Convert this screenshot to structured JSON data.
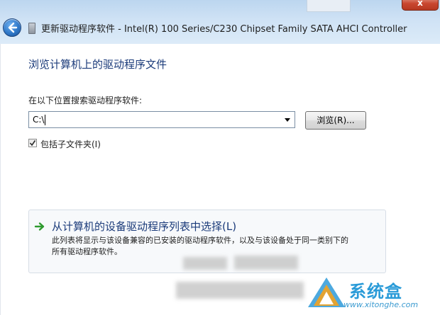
{
  "window": {
    "title": "更新驱动程序软件 - Intel(R) 100 Series/C230 Chipset Family SATA AHCI Controller",
    "close_glyph": "x",
    "background_window_fragment": "",
    "back_icon": "back-arrow-icon",
    "device_icon": "device-icon"
  },
  "page": {
    "heading": "浏览计算机上的驱动程序文件",
    "search_label": "在以下位置搜索驱动程序软件:",
    "path_value": "C:\\",
    "browse_label": "浏览(R)...",
    "include_subfolders_label": "包括子文件夹(I)",
    "include_subfolders_checked": true
  },
  "pick_option": {
    "icon": "green-arrow-icon",
    "title": "从计算机的设备驱动程序列表中选择(L)",
    "description_line1": "此列表将显示与该设备兼容的已安装的驱动程序软件，以及与该设备处于同一类别下的",
    "description_line2": "所有驱动程序软件。"
  },
  "watermark": {
    "name": "系统盒",
    "url": "www.xitonghe.com"
  },
  "colors": {
    "heading_blue": "#1b3b7a",
    "link_arrow_green": "#2e9a2e",
    "titlebar": "#cfe2f5",
    "watermark_blue": "#2a9bd8"
  }
}
